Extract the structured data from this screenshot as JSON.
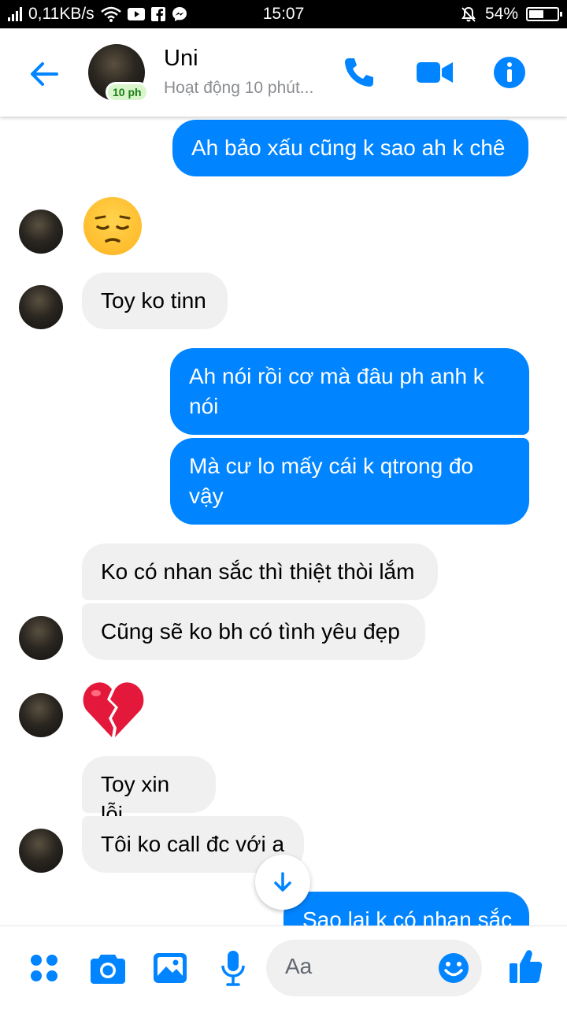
{
  "status_bar": {
    "speed": "0,11KB/s",
    "time": "15:07",
    "battery": "54%",
    "battery_level": 0.54
  },
  "header": {
    "contact_name": "Uni",
    "active_status": "Hoạt động 10 phút...",
    "avatar_badge": "10 ph",
    "icons": [
      "back-arrow-icon",
      "phone-icon",
      "video-camera-icon",
      "info-icon"
    ]
  },
  "messages": [
    {
      "from": "me",
      "text": "Ah bảo xấu cũng k sao ah k chê"
    },
    {
      "from": "them",
      "emoji": "pensive-face"
    },
    {
      "from": "them",
      "text": "Toy ko tinn"
    },
    {
      "from": "me",
      "text": "Ah nói rồi cơ mà đâu ph anh k nói"
    },
    {
      "from": "me",
      "text": "Mà cư lo mấy cái k qtrong đo vậy"
    },
    {
      "from": "them",
      "text": "Ko có nhan sắc thì thiệt thòi lắm"
    },
    {
      "from": "them",
      "text": "Cũng sẽ ko bh có tình yêu đẹp"
    },
    {
      "from": "them",
      "emoji": "broken-heart"
    },
    {
      "from": "them",
      "text": "Toy xin lỗi"
    },
    {
      "from": "them",
      "text": "Tôi ko call đc với a"
    },
    {
      "from": "me",
      "text": "Sao lại k có nhan sắc"
    }
  ],
  "composer": {
    "placeholder": "Aa",
    "icons": [
      "more-grid-icon",
      "camera-icon",
      "gallery-icon",
      "microphone-icon",
      "emoji-icon",
      "thumbs-up-icon"
    ]
  },
  "colors": {
    "accent": "#0084ff",
    "incoming_bubble": "#f1f0f0",
    "outgoing_bubble": "#0084ff"
  }
}
